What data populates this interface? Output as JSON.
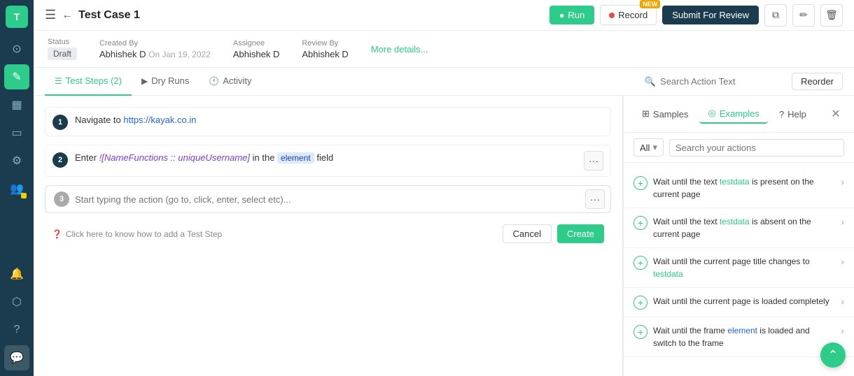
{
  "sidebar": {
    "logo": "T",
    "items": [
      {
        "id": "dashboard",
        "icon": "⊙",
        "active": false
      },
      {
        "id": "edit",
        "icon": "✎",
        "active": true
      },
      {
        "id": "projects",
        "icon": "▦",
        "active": false
      },
      {
        "id": "monitor",
        "icon": "▭",
        "active": false
      },
      {
        "id": "settings",
        "icon": "⚙",
        "active": false
      },
      {
        "id": "team",
        "icon": "👥",
        "active": false
      },
      {
        "id": "notifications",
        "icon": "🔔",
        "active": false
      },
      {
        "id": "integrations",
        "icon": "⬡",
        "active": false
      },
      {
        "id": "help",
        "icon": "?",
        "active": false
      },
      {
        "id": "chat",
        "icon": "💬",
        "active": false
      }
    ]
  },
  "topbar": {
    "title": "Test Case 1",
    "run_label": "Run",
    "record_label": "Record",
    "record_badge": "NEW",
    "submit_label": "Submit For Review"
  },
  "meta": {
    "status_label": "Status",
    "status_value": "Draft",
    "created_by_label": "Created By",
    "created_by_name": "Abhishek D",
    "created_by_date": "On Jan 19, 2022",
    "assignee_label": "Assignee",
    "assignee_value": "Abhishek D",
    "review_by_label": "Review By",
    "review_by_value": "Abhishek D",
    "more_details": "More details..."
  },
  "tabs": [
    {
      "id": "test-steps",
      "label": "Test Steps (2)",
      "icon": "☰",
      "active": true
    },
    {
      "id": "dry-runs",
      "label": "Dry Runs",
      "icon": "▶",
      "active": false
    },
    {
      "id": "activity",
      "label": "Activity",
      "icon": "🕐",
      "active": false
    }
  ],
  "search_placeholder": "Search Action Text",
  "reorder_label": "Reorder",
  "steps": [
    {
      "num": "1",
      "text_parts": [
        {
          "type": "plain",
          "text": "Navigate to "
        },
        {
          "type": "url",
          "text": "https://kayak.co.in"
        }
      ]
    },
    {
      "num": "2",
      "text_parts": [
        {
          "type": "plain",
          "text": "Enter "
        },
        {
          "type": "func",
          "text": "![NameFunctions :: uniqueUsername]"
        },
        {
          "type": "plain",
          "text": " in the "
        },
        {
          "type": "element",
          "text": "element"
        },
        {
          "type": "plain",
          "text": " field"
        }
      ]
    }
  ],
  "step_input": {
    "num": "3",
    "placeholder": "Start typing the action (go to, click, enter, select etc)..."
  },
  "help_link": "Click here to know how to add a Test Step",
  "cancel_label": "Cancel",
  "create_label": "Create",
  "right_panel": {
    "tabs": [
      {
        "id": "samples",
        "label": "Samples",
        "icon": "⊞",
        "active": false
      },
      {
        "id": "examples",
        "label": "Examples",
        "icon": "◎",
        "active": true
      },
      {
        "id": "help",
        "label": "Help",
        "icon": "?",
        "active": false
      }
    ],
    "filter": {
      "all_label": "All",
      "search_placeholder": "Search your actions"
    },
    "actions": [
      {
        "id": "action-1",
        "text": "Wait until the text  testdata  is present on the current page"
      },
      {
        "id": "action-2",
        "text": "Wait until the text  testdata  is absent on the current page"
      },
      {
        "id": "action-3",
        "text": "Wait until the current page title changes to  testdata"
      },
      {
        "id": "action-4",
        "text": "Wait until the current page is loaded completely"
      },
      {
        "id": "action-5",
        "text": "Wait until the frame  element  is loaded and switch to the frame"
      }
    ]
  }
}
